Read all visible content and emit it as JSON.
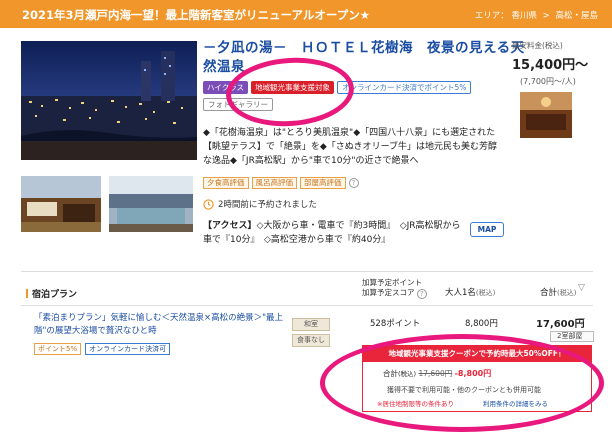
{
  "header": {
    "title": "2021年3月瀬戸内海一望！最上階新客室がリニューアルオープン★",
    "area_label": "エリア：",
    "area_region": "香川県",
    "area_separator": ">",
    "area_city": "高松・屋島"
  },
  "hotel": {
    "name": "－夕凪の湯－　ＨＯＴＥＬ花樹海　夜景の見える天然温泉",
    "badges": {
      "high_class": "ハイクラス",
      "regional_support": "地域観光事業支援対象",
      "online_card_points": "オンラインカード決済でポイント5%",
      "photo_gallery": "フォトギャラリー"
    },
    "price_label": "最安料金(税込)",
    "price_main": "15,400円～",
    "price_sub": "(7,700円～/人)",
    "description": "◆「花樹海温泉」は\"とろり美肌温泉\"◆「四国八十八景」にも選定された【眺望テラス】で「絶景」を◆「さぬきオリーブ牛」は地元民も美む芳醇な逸品◆「JR高松駅」から\"車で10分\"の近さで絶景へ",
    "evaluations": [
      "夕食高評価",
      "風呂高評価",
      "部屋高評価"
    ],
    "help_mark": "?",
    "recent_booking": "2時間前に予約されました",
    "access_label": "【アクセス】",
    "access_text": "◇大阪から車・電車で『約3時間』　◇JR高松駅から車で『10分』　◇高松空港から車で『約40分』",
    "map_label": "MAP"
  },
  "plans_header": {
    "title": "宿泊プラン",
    "points_label_1": "加算予定ポイント",
    "points_label_2": "加算予定スコア",
    "help_mark": "?",
    "adult_label": "大人1名",
    "adult_tax": "(税込)",
    "total_label": "合計",
    "total_tax": "(税込)",
    "sort_arrow": "▽"
  },
  "plan": {
    "name": "「素泊まりプラン」気軽に愉しむ＜天然温泉×高松の絶景＞\"最上階\"の展望大浴場で贅沢なひと時",
    "badges": [
      "ポイント5%",
      "オンラインカード決済可"
    ],
    "room_type": "和室",
    "meal": "食事なし",
    "points": "528ポイント",
    "adult_price": "8,800円",
    "total_price": "17,600円",
    "room_button": "2室部屋",
    "arrow": "▽"
  },
  "coupon": {
    "banner": "地域観光事業支援クーポンで予約時最大50%OFF！",
    "total_label": "合計",
    "total_tax": "(税込)",
    "original_price": "17,600円",
    "discount": "-8,800円",
    "note": "獲得不要で利用可能・他のクーポンとも併用可能",
    "condition": "※居住地制限等の条件あり",
    "terms_link": "利用条件の詳細をみる"
  },
  "colors": {
    "header_orange": "#f0962a",
    "link_blue": "#1b4ea3",
    "coupon_red": "#e8253a",
    "highlight_pink": "#e8187d"
  }
}
